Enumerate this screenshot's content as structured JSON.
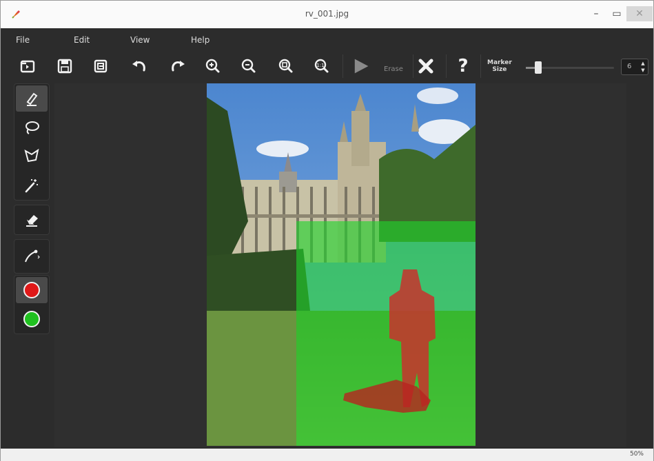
{
  "window": {
    "title": "rv_001.jpg",
    "minimize": "–",
    "maximize": "▭",
    "close": "✕"
  },
  "menu": [
    "File",
    "Edit",
    "View",
    "Help"
  ],
  "toolbar": {
    "open": "open-folder-icon",
    "save": "save-icon",
    "save_as": "save-as-icon",
    "undo": "undo-icon",
    "redo": "redo-icon",
    "zoom_in": "zoom-in-icon",
    "zoom_out": "zoom-out-icon",
    "zoom_fit": "zoom-fit-icon",
    "zoom_reset": "zoom-reset-icon",
    "erase_label": "Erase",
    "clear": "clear-icon",
    "help": "?",
    "marker_label_1": "Marker",
    "marker_label_2": "Size",
    "marker_size_fraction": 0.1,
    "marker_size_value": "6"
  },
  "tools": [
    "pencil-icon",
    "lasso-icon",
    "polygon-lasso-icon",
    "magic-wand-icon",
    "eraser-icon",
    "line-icon",
    "red-marker",
    "green-marker"
  ],
  "colors": {
    "foreground_marker": "#e01818",
    "background_marker": "#1fc01f",
    "app_bg": "#2c2c2c"
  },
  "status": {
    "zoom": "50%"
  }
}
